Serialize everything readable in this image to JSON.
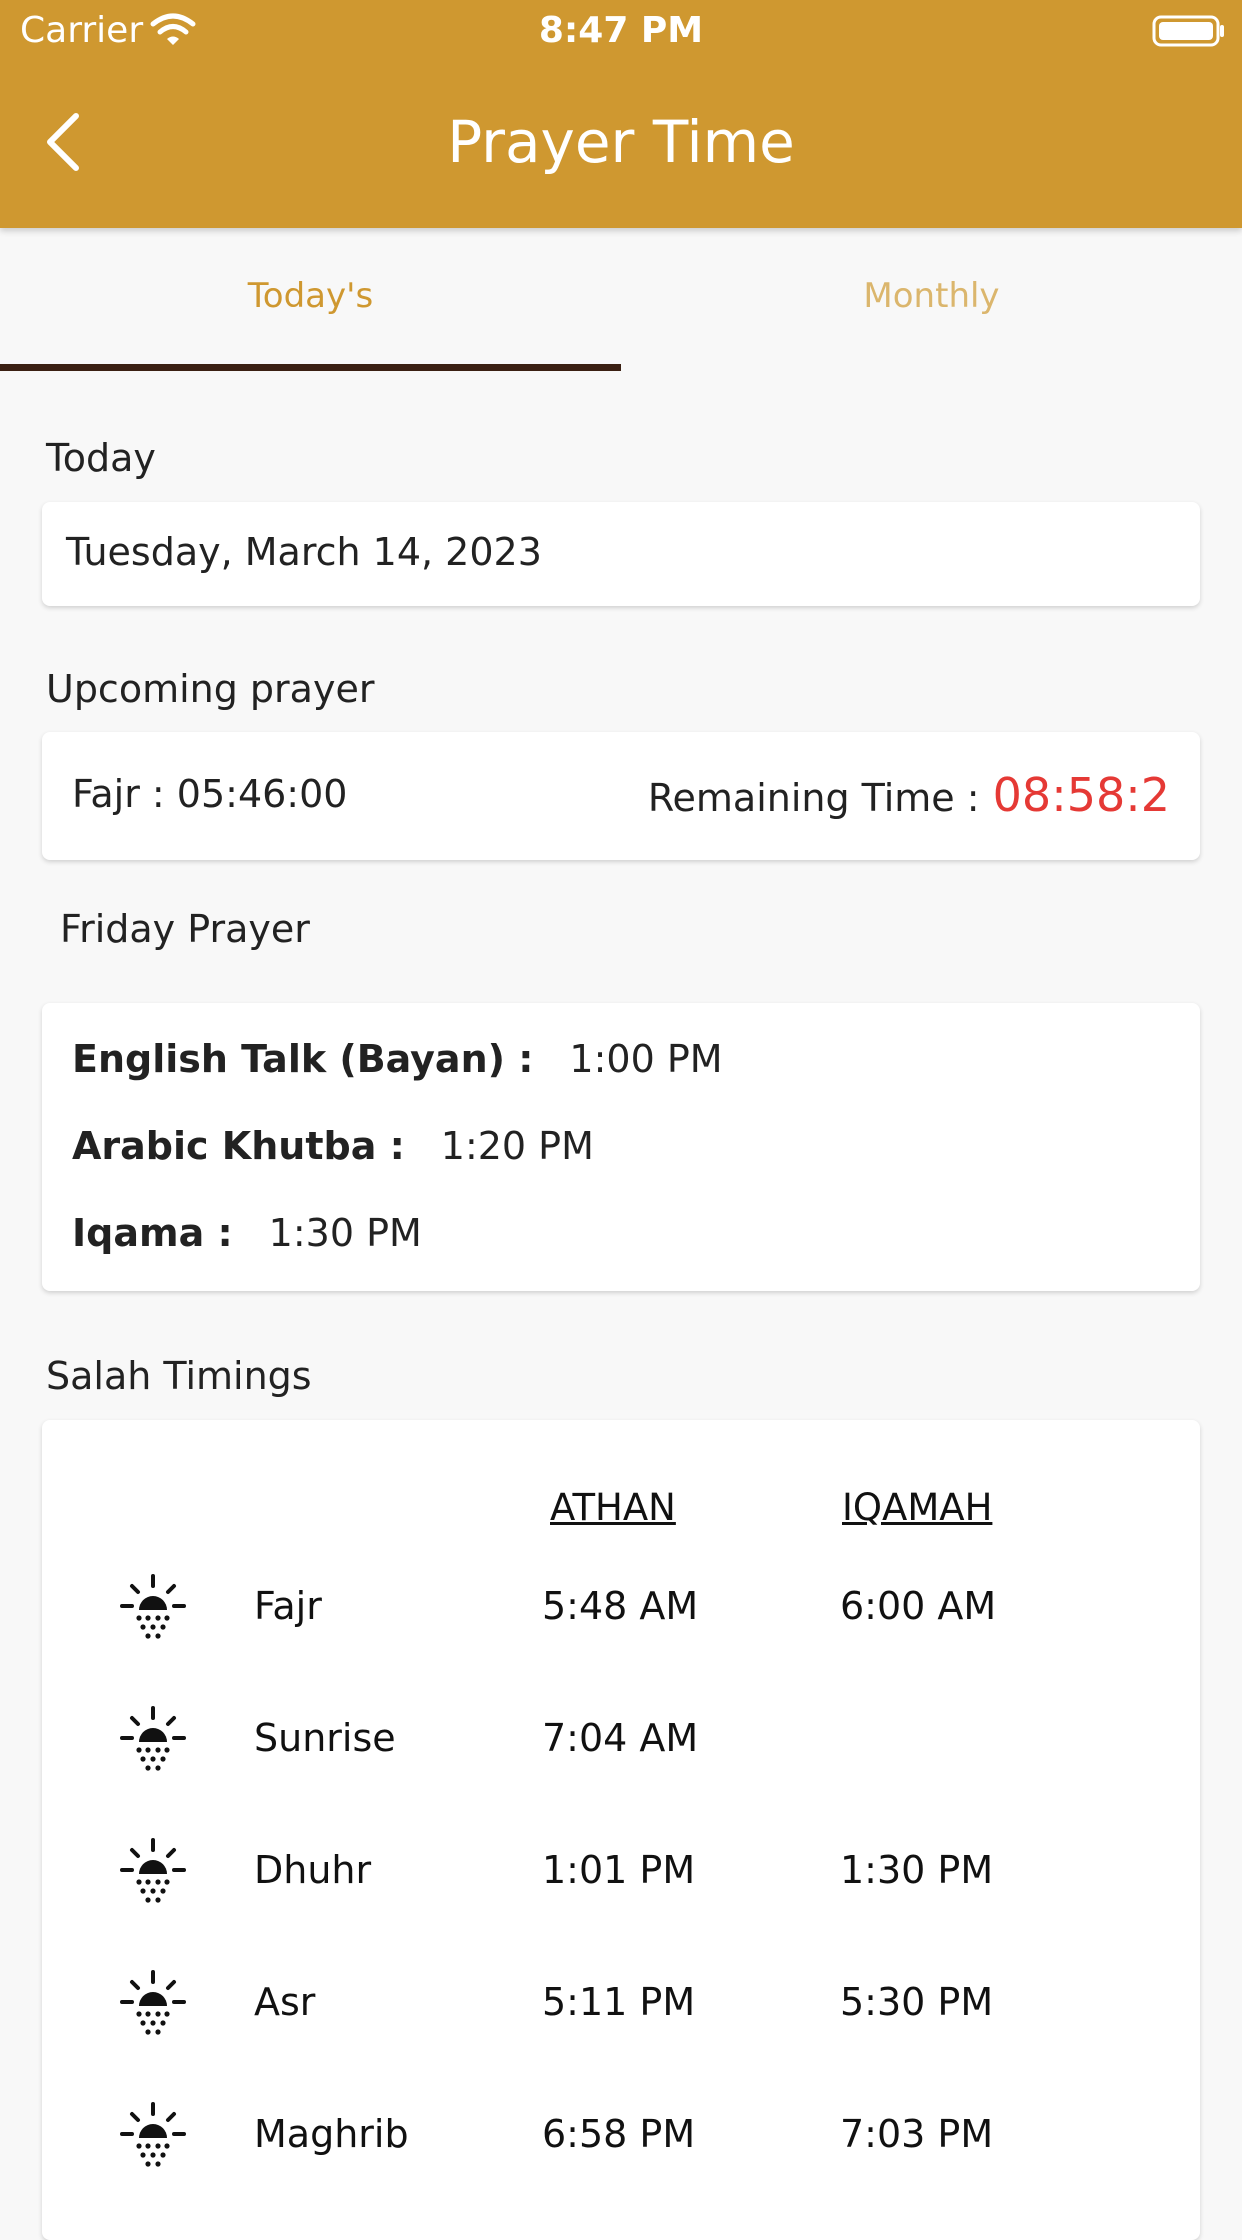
{
  "status_bar": {
    "carrier": "Carrier",
    "time": "8:47 PM"
  },
  "header": {
    "title": "Prayer Time",
    "back_icon": "chevron-left-icon"
  },
  "tabs": [
    {
      "label": "Today's",
      "selected": true
    },
    {
      "label": "Monthly",
      "selected": false
    }
  ],
  "today": {
    "label": "Today",
    "date": "Tuesday, March 14, 2023"
  },
  "upcoming": {
    "label": "Upcoming prayer",
    "prayer": "Fajr : 05:46:00",
    "remaining_label": "Remaining Time :",
    "remaining_value": "08:58:2"
  },
  "friday": {
    "label": "Friday Prayer",
    "rows": [
      {
        "label": "English Talk (Bayan) :",
        "time": "1:00 PM"
      },
      {
        "label": "Arabic Khutba :",
        "time": "1:20 PM"
      },
      {
        "label": "Iqama :",
        "time": "1:30 PM"
      }
    ]
  },
  "salah": {
    "label": "Salah Timings",
    "athan_header": "ATHAN",
    "iqamah_header": "IQAMAH",
    "rows": [
      {
        "name": "Fajr",
        "athan": "5:48 AM",
        "iqamah": "6:00 AM",
        "icon": "sunrise-icon"
      },
      {
        "name": "Sunrise",
        "athan": "7:04 AM",
        "iqamah": "",
        "icon": "sunrise-icon"
      },
      {
        "name": "Dhuhr",
        "athan": "1:01 PM",
        "iqamah": "1:30 PM",
        "icon": "sunrise-icon"
      },
      {
        "name": "Asr",
        "athan": "5:11 PM",
        "iqamah": "5:30 PM",
        "icon": "sunrise-icon"
      },
      {
        "name": "Maghrib",
        "athan": "6:58 PM",
        "iqamah": "7:03 PM",
        "icon": "sunrise-icon"
      }
    ]
  },
  "colors": {
    "header": "#cf9830",
    "tab_selected": "#cf9830",
    "tab_unselected": "#dbb66d",
    "tab_indicator": "#3b2013",
    "remaining_value": "#e53935"
  }
}
